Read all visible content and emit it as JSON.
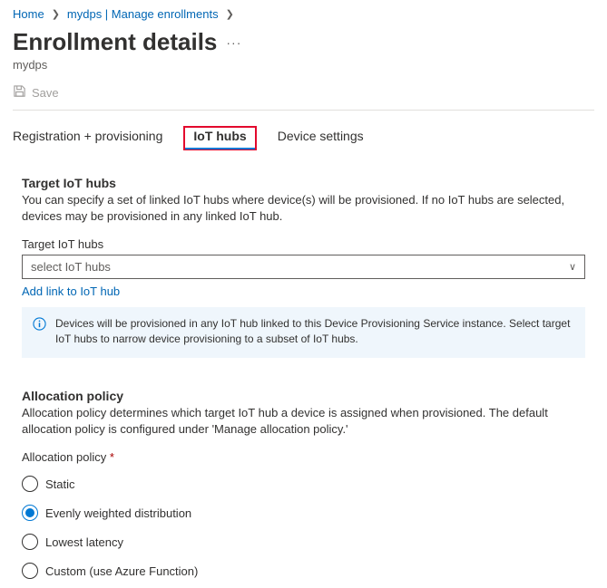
{
  "breadcrumb": {
    "home": "Home",
    "second": "mydps | Manage enrollments"
  },
  "header": {
    "title": "Enrollment details",
    "subtitle": "mydps"
  },
  "toolbar": {
    "save_label": "Save"
  },
  "tabs": {
    "registration": "Registration + provisioning",
    "iothubs": "IoT hubs",
    "device": "Device settings"
  },
  "target_section": {
    "title": "Target IoT hubs",
    "desc": "You can specify a set of linked IoT hubs where device(s) will be provisioned. If no IoT hubs are selected, devices may be provisioned in any linked IoT hub.",
    "field_label": "Target IoT hubs",
    "select_placeholder": "select IoT hubs",
    "add_link": "Add link to IoT hub",
    "info_text": "Devices will be provisioned in any IoT hub linked to this Device Provisioning Service instance. Select target IoT hubs to narrow device provisioning to a subset of IoT hubs."
  },
  "allocation_section": {
    "title": "Allocation policy",
    "desc": "Allocation policy determines which target IoT hub a device is assigned when provisioned. The default allocation policy is configured under 'Manage allocation policy.'",
    "field_label": "Allocation policy",
    "options": {
      "static": "Static",
      "evenly": "Evenly weighted distribution",
      "lowest": "Lowest latency",
      "custom": "Custom (use Azure Function)"
    }
  }
}
